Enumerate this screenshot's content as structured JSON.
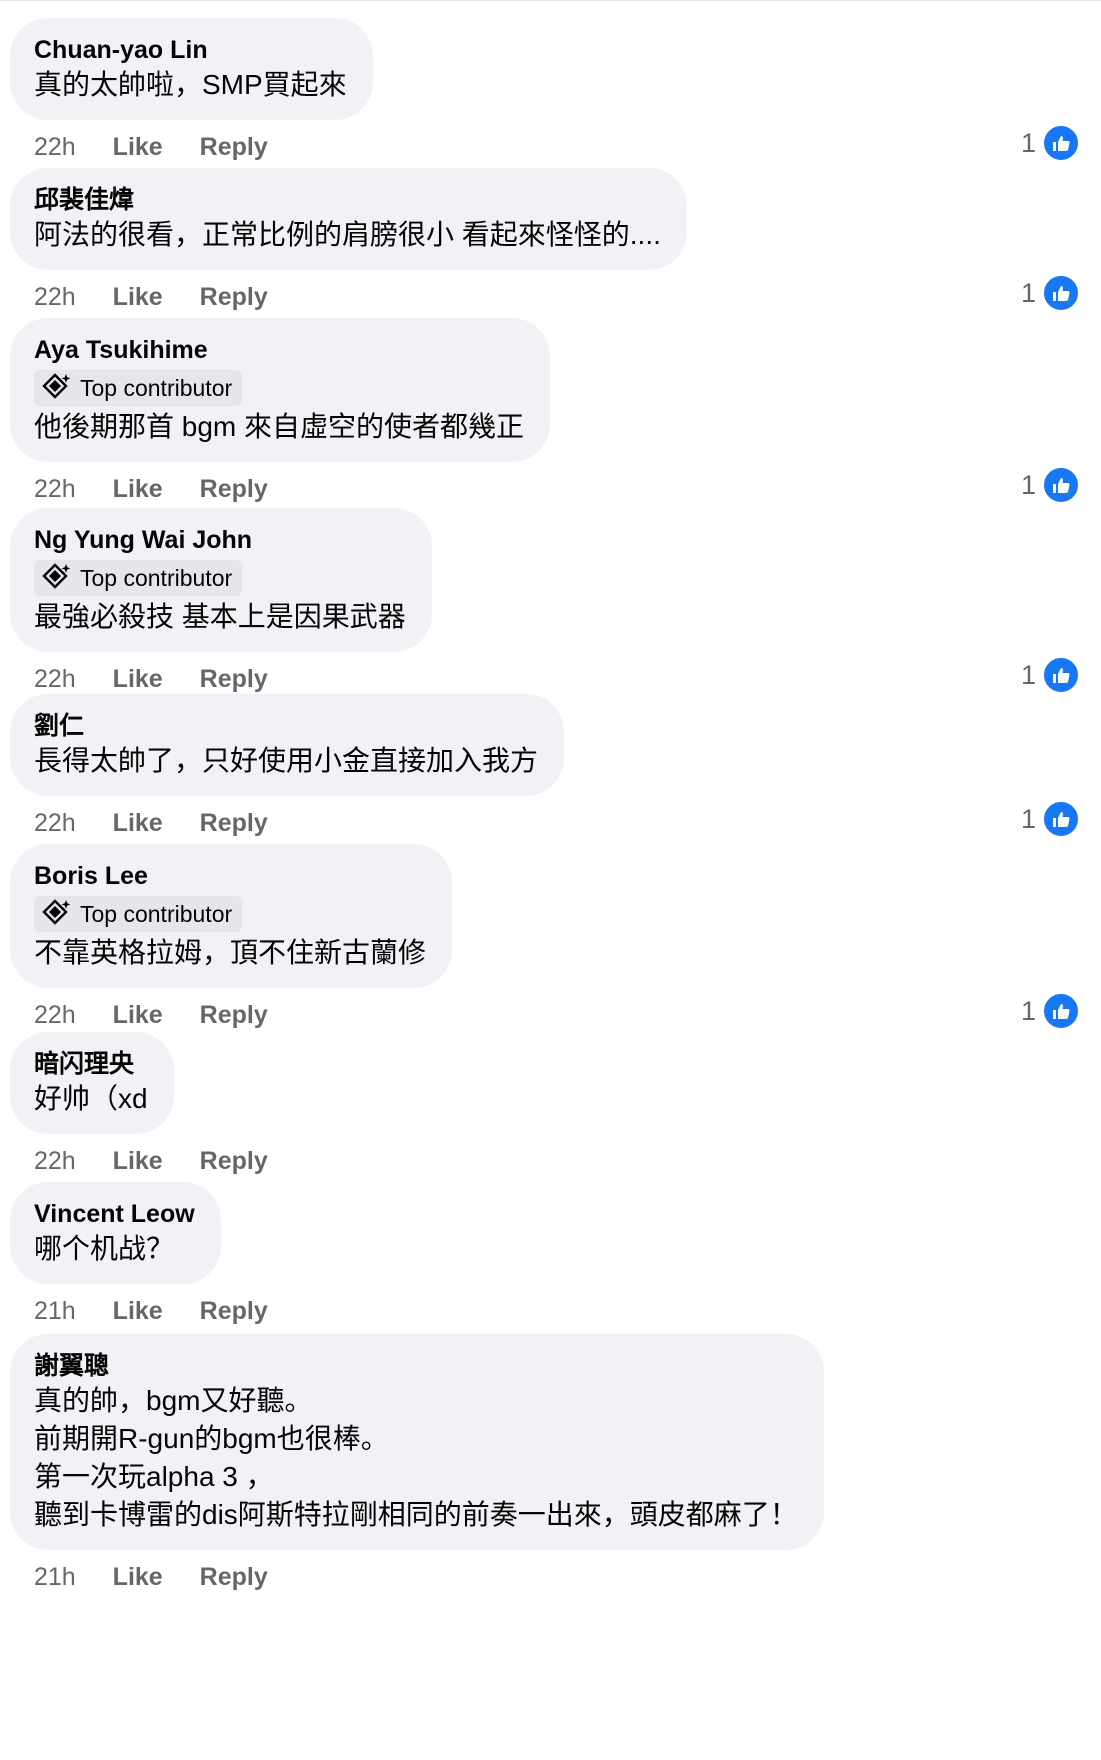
{
  "comments": [
    {
      "author": "Chuan-yao Lin",
      "badge": null,
      "lines": [
        "真的太帥啦，SMP買起來"
      ],
      "time": "22h",
      "like": "Like",
      "reply": "Reply",
      "reactions": "1"
    },
    {
      "author": "邱裴佳煒",
      "badge": null,
      "lines": [
        "阿法的很看，正常比例的肩膀很小 看起來怪怪的...."
      ],
      "time": "22h",
      "like": "Like",
      "reply": "Reply",
      "reactions": "1"
    },
    {
      "author": "Aya Tsukihime",
      "badge": "Top contributor",
      "lines": [
        "他後期那首 bgm 來自虛空的使者都幾正"
      ],
      "time": "22h",
      "like": "Like",
      "reply": "Reply",
      "reactions": "1"
    },
    {
      "author": "Ng Yung Wai John",
      "badge": "Top contributor",
      "lines": [
        "最強必殺技 基本上是因果武器"
      ],
      "time": "22h",
      "like": "Like",
      "reply": "Reply",
      "reactions": "1"
    },
    {
      "author": "劉仁",
      "badge": null,
      "lines": [
        "長得太帥了，只好使用小金直接加入我方"
      ],
      "time": "22h",
      "like": "Like",
      "reply": "Reply",
      "reactions": "1"
    },
    {
      "author": "Boris Lee",
      "badge": "Top contributor",
      "lines": [
        "不靠英格拉姆，頂不住新古蘭修"
      ],
      "time": "22h",
      "like": "Like",
      "reply": "Reply",
      "reactions": "1"
    },
    {
      "author": "暗闪理央",
      "badge": null,
      "lines": [
        "好帅（xd"
      ],
      "time": "22h",
      "like": "Like",
      "reply": "Reply",
      "reactions": null
    },
    {
      "author": "Vincent Leow",
      "badge": null,
      "lines": [
        "哪个机战？"
      ],
      "time": "21h",
      "like": "Like",
      "reply": "Reply",
      "reactions": null
    },
    {
      "author": "謝翼聰",
      "badge": null,
      "lines": [
        "真的帥，bgm又好聽。",
        "前期開R-gun的bgm也很棒。",
        "第一次玩alpha 3 ，",
        "聽到卡博雷的dis阿斯特拉剛相同的前奏一出來，頭皮都麻了！"
      ],
      "time": "21h",
      "like": "Like",
      "reply": "Reply",
      "reactions": null
    }
  ],
  "colors": {
    "bubble": "#f0f2f5",
    "meta": "#65676b",
    "like_blue": "#1877f2",
    "badge_bg": "#e4e6eb"
  },
  "icons": {
    "badge": "top-contributor-badge-icon",
    "reaction": "like-thumb-icon"
  }
}
